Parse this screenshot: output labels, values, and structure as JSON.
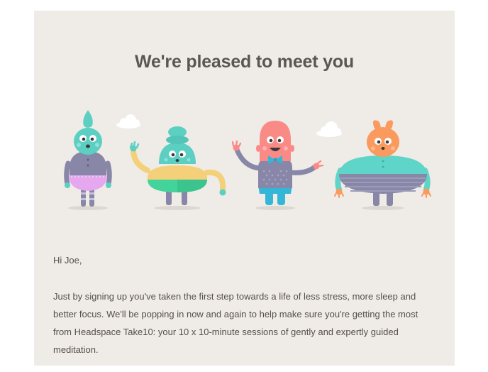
{
  "email": {
    "headline": "We're pleased to meet you",
    "greeting": "Hi Joe,",
    "body": "Just by signing up you've taken the first step towards a life of less stress, more sleep and better focus. We'll be popping in now and again to help make sure you're getting the most from Headspace Take10: your 10 x 10-minute sessions of gently and expertly guided meditation."
  },
  "colors": {
    "card_background": "#efebe6",
    "headline_text": "#5a5651",
    "body_text": "#555048"
  },
  "illustration": {
    "characters": [
      "teal-dress-character",
      "yellow-arm-character",
      "pink-bowtie-character",
      "orange-round-character"
    ],
    "decorations": [
      "cloud-icon",
      "cloud-icon"
    ]
  }
}
